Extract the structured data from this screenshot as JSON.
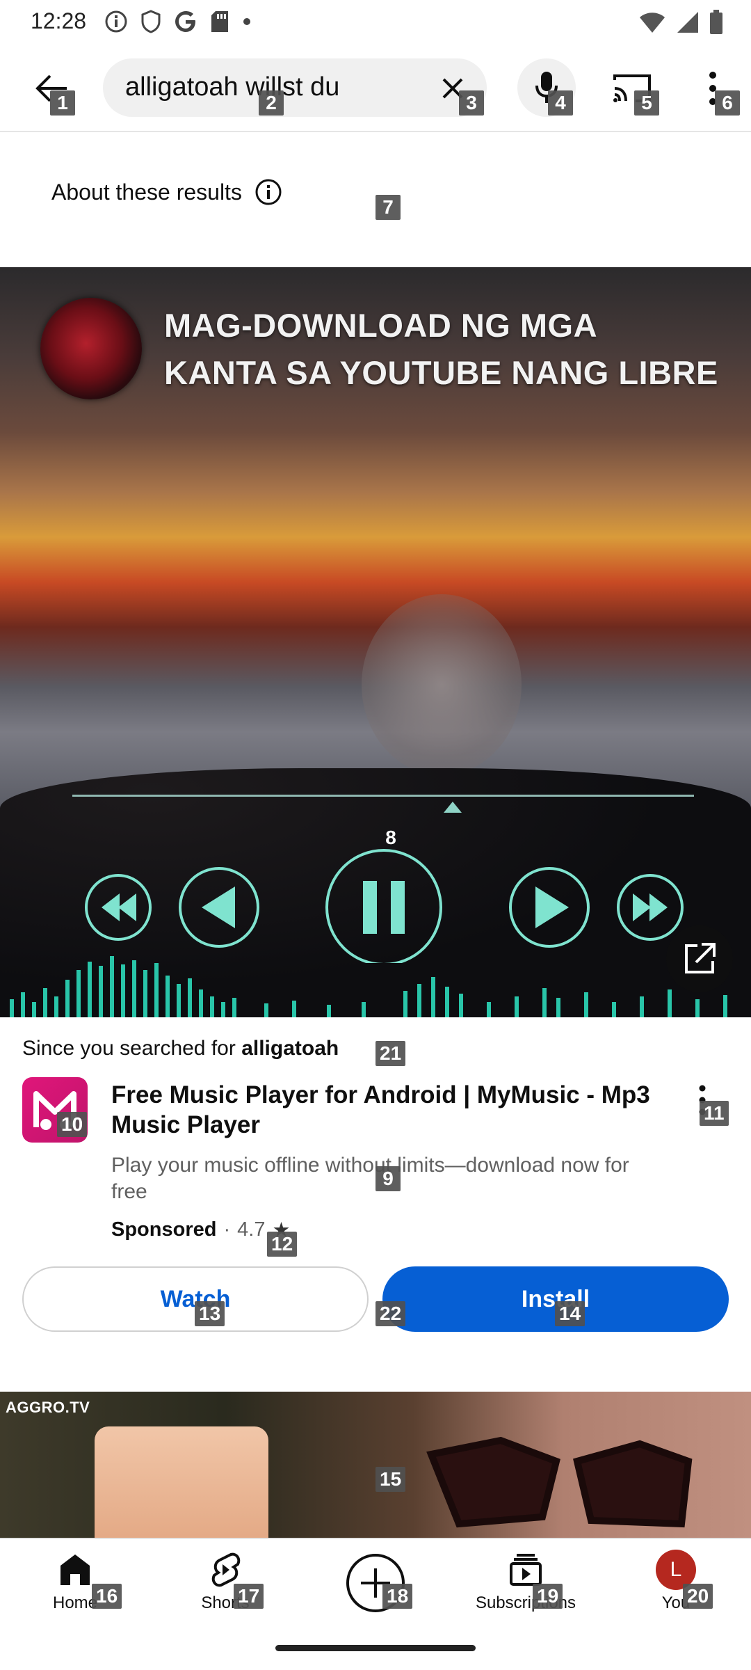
{
  "status": {
    "time": "12:28"
  },
  "search": {
    "query": "alligatoah willst du"
  },
  "about": {
    "label": "About these results"
  },
  "video": {
    "overlay_line1": "MAG-DOWNLOAD NG MGA",
    "overlay_line2": "KANTA SA YOUTUBE NANG LIBRE"
  },
  "ad": {
    "since_prefix": "Since you searched for ",
    "since_term": "alligatoah",
    "title": "Free Music Player for Android | MyMusic - Mp3 Music Player",
    "description": "Play your music offline without limits—download now for free",
    "sponsored": "Sponsored",
    "separator": "·",
    "rating": "4.7",
    "rating_star": "★",
    "watch_label": "Watch",
    "install_label": "Install"
  },
  "next_video": {
    "channel_label": "AGGRO.TV"
  },
  "nav": {
    "items": [
      {
        "label": "Home"
      },
      {
        "label": "Shorts"
      },
      {
        "label": ""
      },
      {
        "label": "Subscriptions"
      },
      {
        "label": "You",
        "avatar_letter": "L"
      }
    ]
  },
  "badges": [
    "1",
    "2",
    "3",
    "4",
    "5",
    "6",
    "7",
    "8",
    "9",
    "10",
    "11",
    "12",
    "13",
    "14",
    "15",
    "16",
    "17",
    "18",
    "19",
    "20",
    "21",
    "22"
  ],
  "colors": {
    "accent": "#065fd4",
    "ad_logo": "#d6157a",
    "avatar": "#b5281f"
  }
}
